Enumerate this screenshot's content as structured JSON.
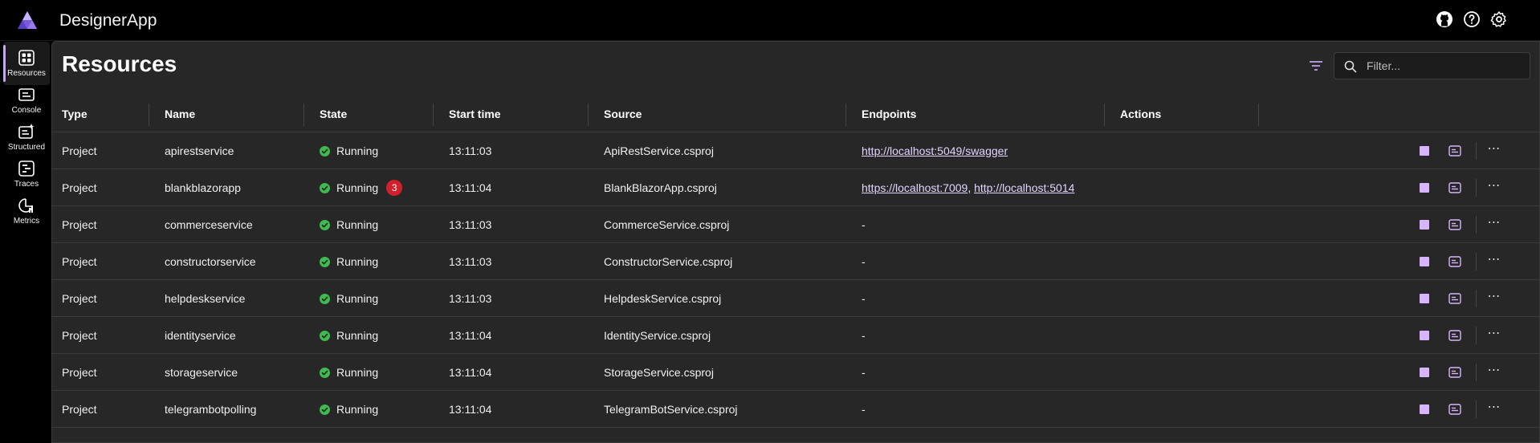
{
  "app": {
    "title": "DesignerApp"
  },
  "header_icons": [
    "github-icon",
    "help-icon",
    "settings-icon"
  ],
  "sidebar": {
    "items": [
      {
        "label": "Resources",
        "icon": "resources-icon",
        "active": true
      },
      {
        "label": "Console",
        "icon": "console-icon",
        "active": false
      },
      {
        "label": "Structured",
        "icon": "structured-icon",
        "active": false
      },
      {
        "label": "Traces",
        "icon": "traces-icon",
        "active": false
      },
      {
        "label": "Metrics",
        "icon": "metrics-icon",
        "active": false
      }
    ]
  },
  "main": {
    "title": "Resources",
    "filter": {
      "placeholder": "Filter..."
    }
  },
  "table": {
    "columns": [
      "Type",
      "Name",
      "State",
      "Start time",
      "Source",
      "Endpoints",
      "Actions"
    ],
    "rows": [
      {
        "type": "Project",
        "name": "apirestservice",
        "state": "Running",
        "start": "13:11:03",
        "source": "ApiRestService.csproj",
        "endpoints": [
          "http://localhost:5049/swagger"
        ],
        "badge": ""
      },
      {
        "type": "Project",
        "name": "blankblazorapp",
        "state": "Running",
        "start": "13:11:04",
        "source": "BlankBlazorApp.csproj",
        "endpoints": [
          "https://localhost:7009",
          "http://localhost:5014"
        ],
        "badge": "3"
      },
      {
        "type": "Project",
        "name": "commerceservice",
        "state": "Running",
        "start": "13:11:03",
        "source": "CommerceService.csproj",
        "endpoints": [],
        "badge": ""
      },
      {
        "type": "Project",
        "name": "constructorservice",
        "state": "Running",
        "start": "13:11:03",
        "source": "ConstructorService.csproj",
        "endpoints": [],
        "badge": ""
      },
      {
        "type": "Project",
        "name": "helpdeskservice",
        "state": "Running",
        "start": "13:11:03",
        "source": "HelpdeskService.csproj",
        "endpoints": [],
        "badge": ""
      },
      {
        "type": "Project",
        "name": "identityservice",
        "state": "Running",
        "start": "13:11:04",
        "source": "IdentityService.csproj",
        "endpoints": [],
        "badge": ""
      },
      {
        "type": "Project",
        "name": "storageservice",
        "state": "Running",
        "start": "13:11:04",
        "source": "StorageService.csproj",
        "endpoints": [],
        "badge": ""
      },
      {
        "type": "Project",
        "name": "telegrambotpolling",
        "state": "Running",
        "start": "13:11:04",
        "source": "TelegramBotService.csproj",
        "endpoints": [],
        "badge": ""
      }
    ],
    "empty_endpoint": "-",
    "endpoint_separator": ", "
  },
  "colors": {
    "accent": "#c6a6f5",
    "running": "#3fb950",
    "badge": "#d1202b",
    "link": "#e2d3ff"
  }
}
